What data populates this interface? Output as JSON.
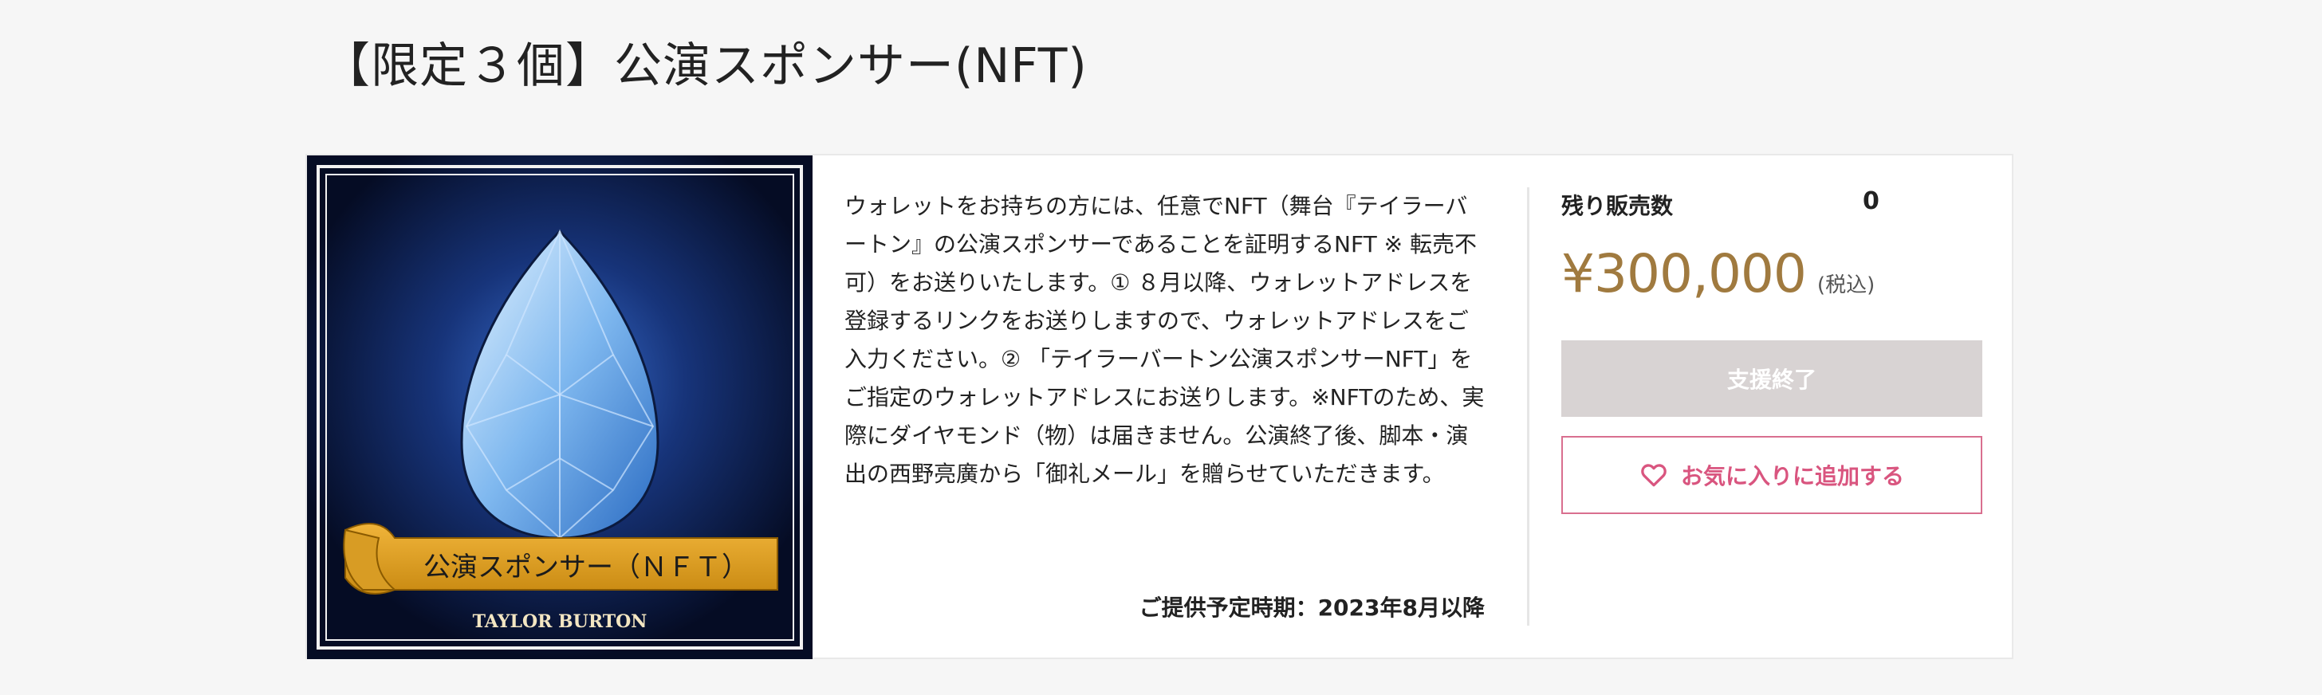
{
  "page": {
    "title": "【限定３個】公演スポンサー(NFT)"
  },
  "product": {
    "image": {
      "banner_text": "公演スポンサー（ＮＦＴ）",
      "caption": "TAYLOR BURTON"
    },
    "description": "ウォレットをお持ちの方には、任意でNFT（舞台『テイラーバートン』の公演スポンサーであることを証明するNFT ※ 転売不可）をお送りいたします。① ８月以降、ウォレットアドレスを登録するリンクをお送りしますので、ウォレットアドレスをご入力ください。② 「テイラーバートン公演スポンサーNFT」をご指定のウォレットアドレスにお送りします。※NFTのため、実際にダイヤモンド（物）は届きません。公演終了後、脚本・演出の西野亮廣から「御礼メール」を贈らせていただきます。",
    "delivery": "ご提供予定時期：2023年8月以降"
  },
  "sidebar": {
    "remaining_label": "残り販売数",
    "remaining_value": "0",
    "price": "¥300,000",
    "tax_note": "(税込)",
    "ended_button": "支援終了",
    "favorite_button": "お気に入りに追加する",
    "favorite_icon": "heart-icon"
  },
  "colors": {
    "price": "#a07a3f",
    "favorite": "#d9557f",
    "ended_button_bg": "#d8d3d3"
  }
}
